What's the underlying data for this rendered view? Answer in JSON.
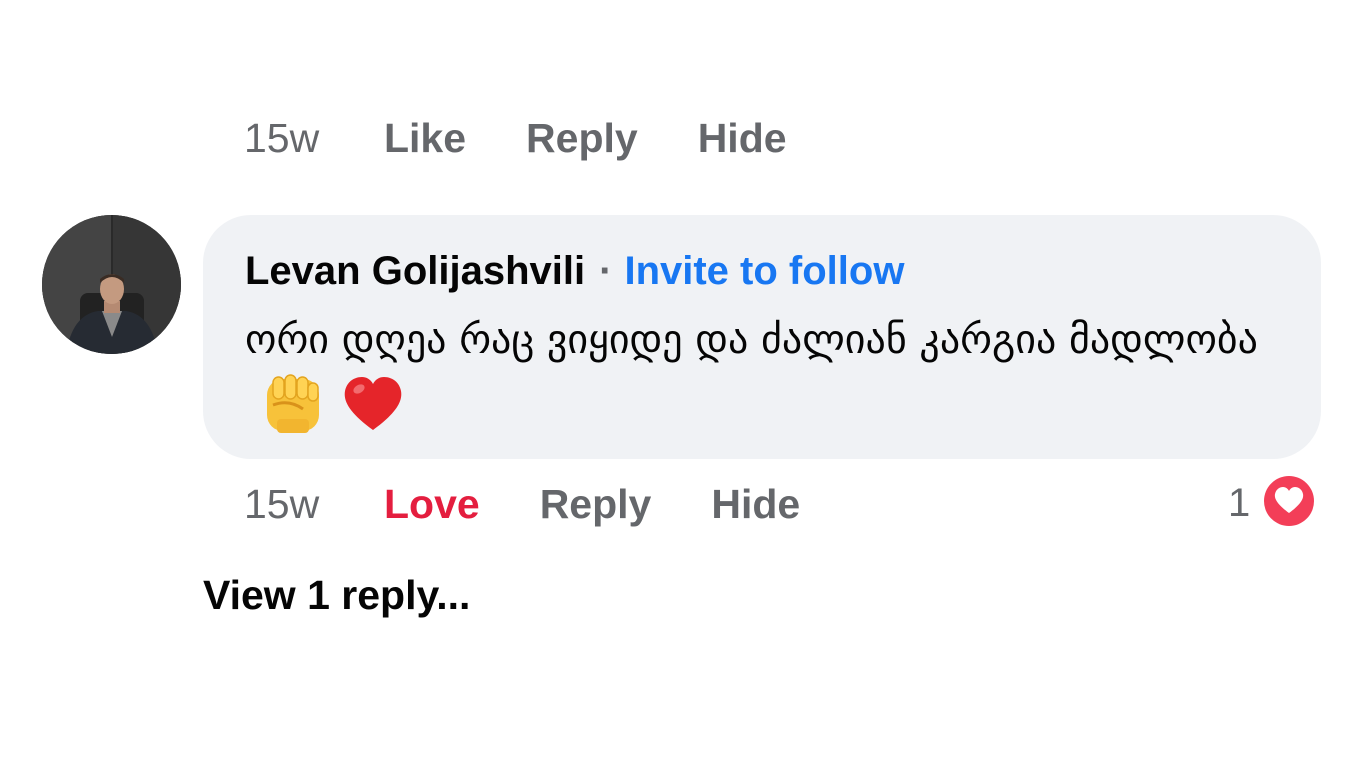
{
  "previous_comment": {
    "time": "15w",
    "actions": {
      "like": "Like",
      "reply": "Reply",
      "hide": "Hide"
    }
  },
  "comment": {
    "author": "Levan Golijashvili",
    "separator": "·",
    "invite": "Invite to follow",
    "text": "ორი დღეა რაც ვიყიდე და ძალიან კარგია მადლობა",
    "emojis": [
      "raised-fist-emoji",
      "red-heart-emoji"
    ],
    "time": "15w",
    "actions": {
      "love": "Love",
      "reply": "Reply",
      "hide": "Hide"
    },
    "reaction_count": "1",
    "reaction_icon": "love-reaction-icon"
  },
  "replies": {
    "view_label": "View 1 reply..."
  },
  "colors": {
    "love": "#e41e3f",
    "link": "#1877f2",
    "bubble": "#f0f2f5",
    "muted": "#65676b"
  }
}
